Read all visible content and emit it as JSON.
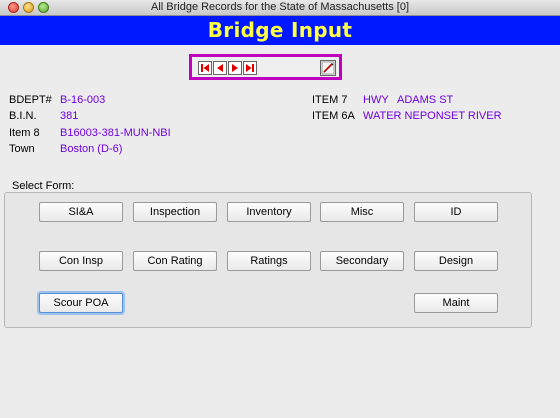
{
  "window": {
    "title": "All Bridge Records for the State of Massachusetts [0]"
  },
  "banner": {
    "title": "Bridge Input"
  },
  "nav": {
    "buttons": [
      "first-record",
      "previous-record",
      "next-record",
      "last-record"
    ],
    "edit_icon": "edit-icon"
  },
  "fields_left": [
    {
      "label": "BDEPT#",
      "value": "B-16-003"
    },
    {
      "label": "B.I.N.",
      "value": "381"
    },
    {
      "label": "Item 8",
      "value": "B16003-381-MUN-NBI"
    },
    {
      "label": "Town",
      "value": "Boston (D-6)"
    }
  ],
  "fields_right": [
    {
      "label": "ITEM 7",
      "value": "HWY   ADAMS ST"
    },
    {
      "label": "ITEM 6A",
      "value": "WATER NEPONSET RIVER"
    }
  ],
  "select_form_label": "Select Form:",
  "form_buttons": {
    "row1": [
      "SI&A",
      "Inspection",
      "Inventory",
      "Misc",
      "ID"
    ],
    "row2": [
      "Con Insp",
      "Con Rating",
      "Ratings",
      "Secondary",
      "Design"
    ],
    "row3_left": "Scour POA",
    "row3_right": "Maint"
  },
  "colors": {
    "banner_bg": "#0018ff",
    "banner_text": "#ffff44",
    "value_text": "#7000e0",
    "nav_border": "#c000c0"
  }
}
